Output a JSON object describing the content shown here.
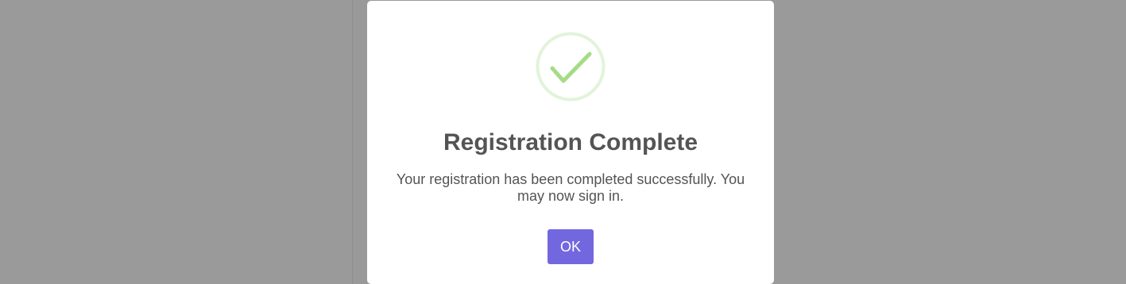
{
  "modal": {
    "title": "Registration Complete",
    "message": "Your registration has been completed successfully. You may now sign in.",
    "ok_label": "OK",
    "icon": "check-icon"
  },
  "colors": {
    "backdrop": "#9a9a9a",
    "modal_background": "#ffffff",
    "success_ring": "#e3f3da",
    "success_check": "#a5dc86",
    "title_text": "#545454",
    "button": "#7367e0",
    "button_text": "#ffffff"
  }
}
